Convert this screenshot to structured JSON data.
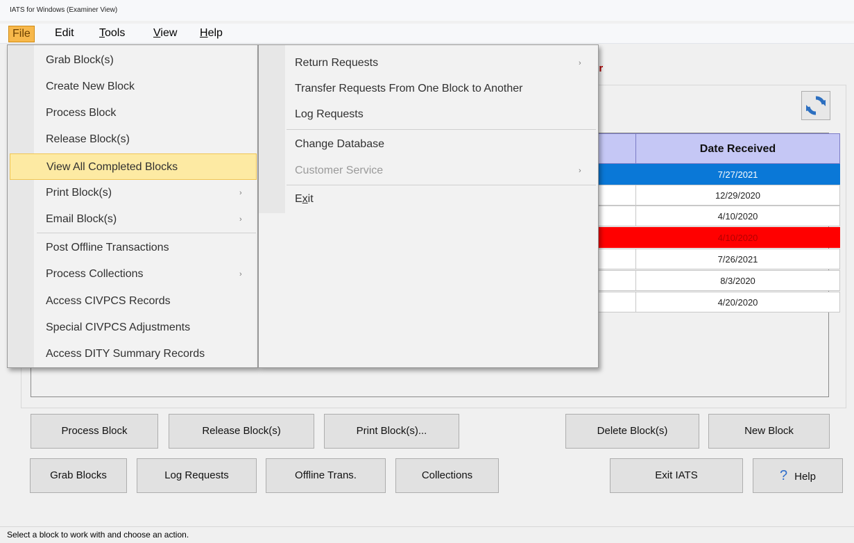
{
  "window": {
    "title": "IATS for Windows (Examiner View)"
  },
  "menubar": {
    "file": "File",
    "edit": "Edit",
    "tools_rest": "ools",
    "tools_u": "T",
    "view_u": "V",
    "view_rest": "iew",
    "help_u": "H",
    "help_rest": "elp"
  },
  "file_menu": {
    "items": [
      "Grab Block(s)",
      "Create New Block",
      "Process Block",
      "Release Block(s)",
      "View All Completed Blocks",
      "Print Block(s)",
      "Email Block(s)",
      "Post Offline Transactions",
      "Process Collections",
      "Access CIVPCS Records",
      "Special CIVPCS Adjustments",
      "Access DITY Summary Records"
    ],
    "highlighted_index": 4
  },
  "sub_menu": {
    "items": [
      "Return Requests",
      "Transfer Requests From One Block to Another",
      "Log Requests",
      "Change Database",
      "Customer Service"
    ],
    "exit_u": "x",
    "exit_a": "E",
    "exit_b": "it"
  },
  "heading_fragment": "er",
  "grid": {
    "column_header": "Date Received",
    "rows": [
      "7/27/2021",
      "12/29/2020",
      "4/10/2020",
      "4/10/2020",
      "7/26/2021",
      "8/3/2020",
      "4/20/2020"
    ],
    "selected_row": 0,
    "error_row": 3
  },
  "panel_buttons": {
    "process": "Process Block",
    "release": "Release Block(s)",
    "print": "Print Block(s)...",
    "delete": "Delete Block(s)",
    "new": "New Block"
  },
  "bottom_buttons": {
    "grab": "Grab Blocks",
    "log": "Log Requests",
    "offline": "Offline Trans.",
    "collections": "Collections",
    "exit": "Exit IATS",
    "help_icon": "?",
    "help": "Help"
  },
  "status": "Select a block to work with and choose an action.",
  "colors": {
    "selection": "#0a78d7",
    "error": "#ff0000",
    "header": "#c5c7f5",
    "menu_highlight": "#fdeaa3",
    "active_menu": "#f7b84b"
  }
}
